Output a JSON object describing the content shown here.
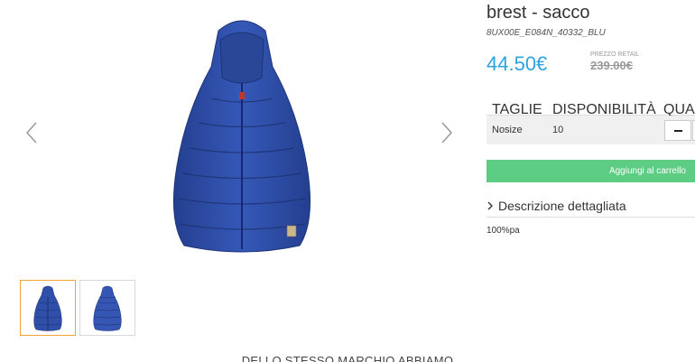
{
  "product": {
    "title": "brest - sacco",
    "sku": "8UX00E_E084N_40332_BLU",
    "price": "44.50€",
    "retail_label": "PREZZO RETAIL",
    "retail_price": "239.00€"
  },
  "stock_table": {
    "headers": [
      "TAGLIE",
      "DISPONIBILITÀ",
      "QUANTITÀ"
    ],
    "rows": [
      {
        "size": "Nosize",
        "availability": "10"
      }
    ]
  },
  "cart_button": "Aggiungi al carrello",
  "description": {
    "toggle_label": "Descrizione dettagliata",
    "text": "100%pa"
  },
  "below_heading": "DELLO STESSO MARCHIO ABBIAMO",
  "colors": {
    "price": "#2ca3e0",
    "cart_button": "#5ccd83",
    "active_thumb_border": "#f2a33a",
    "product_blue": "#2f4fa8"
  },
  "icons": {
    "prev": "chevron-left-icon",
    "next": "chevron-right-icon",
    "desc": "chevron-right-icon",
    "qty_minus": "minus-icon"
  }
}
